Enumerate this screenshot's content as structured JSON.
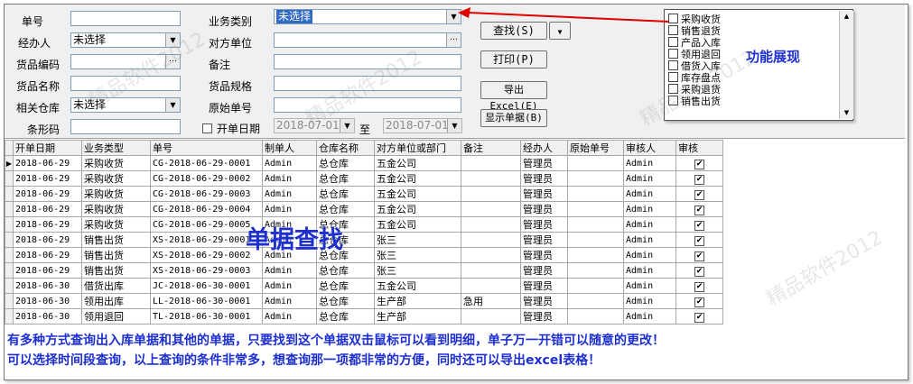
{
  "form": {
    "labels": {
      "doc_no": "单号",
      "handler": "经办人",
      "goods_code": "货品编码",
      "goods_name": "货品名称",
      "warehouse": "相关仓库",
      "barcode": "条形码",
      "biz_type": "业务类别",
      "counterparty": "对方单位",
      "remark": "备注",
      "spec": "货品规格",
      "orig_no": "原始单号",
      "open_date": "开单日期",
      "date_to": "至"
    },
    "values": {
      "doc_no": "",
      "handler": "未选择",
      "goods_code": "",
      "goods_name": "",
      "warehouse": "未选择",
      "barcode": "",
      "biz_type": "未选择",
      "counterparty": "",
      "remark": "",
      "spec": "",
      "orig_no": "",
      "date_from": "2018-07-01",
      "date_to": "2018-07-01"
    },
    "open_date_checked": false
  },
  "buttons": {
    "search": "查找(S)",
    "print": "打印(P)",
    "export": "导出Excel(E)",
    "show_docs": "显示单据(B)"
  },
  "function_list": {
    "items": [
      "采购收货",
      "销售退货",
      "产品入库",
      "领用退回",
      "借货入库",
      "库存盘点",
      "采购退货",
      "销售出货"
    ],
    "label": "功能展现"
  },
  "grid": {
    "columns": [
      "开单日期",
      "业务类型",
      "单号",
      "制单人",
      "仓库名称",
      "对方单位或部门",
      "备注",
      "经办人",
      "原始单号",
      "审核人",
      "审核"
    ],
    "rows": [
      [
        "2018-06-29",
        "采购收货",
        "CG-2018-06-29-0001",
        "Admin",
        "总仓库",
        "五金公司",
        "",
        "管理员",
        "",
        "Admin",
        "✔"
      ],
      [
        "2018-06-29",
        "采购收货",
        "CG-2018-06-29-0002",
        "Admin",
        "总仓库",
        "五金公司",
        "",
        "管理员",
        "",
        "Admin",
        "✔"
      ],
      [
        "2018-06-29",
        "采购收货",
        "CG-2018-06-29-0003",
        "Admin",
        "总仓库",
        "五金公司",
        "",
        "管理员",
        "",
        "Admin",
        "✔"
      ],
      [
        "2018-06-29",
        "采购收货",
        "CG-2018-06-29-0004",
        "Admin",
        "总仓库",
        "五金公司",
        "",
        "管理员",
        "",
        "Admin",
        "✔"
      ],
      [
        "2018-06-29",
        "采购收货",
        "CG-2018-06-29-0005",
        "Admin",
        "总仓库",
        "五金公司",
        "",
        "管理员",
        "",
        "Admin",
        "✔"
      ],
      [
        "2018-06-29",
        "销售出货",
        "XS-2018-06-29-0001",
        "Admin",
        "总仓库",
        "张三",
        "",
        "管理员",
        "",
        "Admin",
        "✔"
      ],
      [
        "2018-06-29",
        "销售出货",
        "XS-2018-06-29-0002",
        "Admin",
        "总仓库",
        "张三",
        "",
        "管理员",
        "",
        "Admin",
        "✔"
      ],
      [
        "2018-06-29",
        "销售出货",
        "XS-2018-06-29-0003",
        "Admin",
        "总仓库",
        "张三",
        "",
        "管理员",
        "",
        "Admin",
        "✔"
      ],
      [
        "2018-06-30",
        "借货出库",
        "JC-2018-06-30-0001",
        "Admin",
        "总仓库",
        "五金公司",
        "",
        "管理员",
        "",
        "Admin",
        "✔"
      ],
      [
        "2018-06-30",
        "领用出库",
        "LL-2018-06-30-0001",
        "Admin",
        "总仓库",
        "生产部",
        "急用",
        "管理员",
        "",
        "Admin",
        "✔"
      ],
      [
        "2018-06-30",
        "领用退回",
        "TL-2018-06-30-0001",
        "Admin",
        "总仓库",
        "生产部",
        "",
        "管理员",
        "",
        "Admin",
        "✔"
      ]
    ]
  },
  "overlay_title": "单据查找",
  "notes": [
    "有多种方式查询出入库单据和其他的单据，只要找到这个单据双击鼠标可以看到明细，单子万一开错可以随意的更改！",
    "可以选择时间段查询，以上查询的条件非常多，想查询那一项都非常的方便，同时还可以导出excel表格！"
  ],
  "watermark": "精品软件2012",
  "colors": {
    "accent": "#1d2fcf",
    "arrow": "#e00000",
    "selection": "#316ac5"
  },
  "icons": {
    "dropdown": "chevron-down-icon",
    "ellipsis": "ellipsis-icon",
    "row_pointer": "triangle-right-icon"
  }
}
